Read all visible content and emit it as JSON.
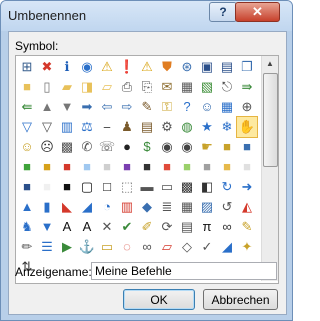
{
  "window": {
    "title": "Umbenennen",
    "help_label": "?",
    "close_label": "✕"
  },
  "symbol_label": "Symbol:",
  "symbols": [
    {
      "name": "org-chart-icon",
      "glyph": "⊞",
      "color": "#355c8c"
    },
    {
      "name": "error-icon",
      "glyph": "✖",
      "color": "#d4382b"
    },
    {
      "name": "info-icon",
      "glyph": "ℹ",
      "color": "#1f5fb8"
    },
    {
      "name": "record-icon",
      "glyph": "◉",
      "color": "#2a6fc9"
    },
    {
      "name": "warning-icon",
      "glyph": "⚠",
      "color": "#d9a413"
    },
    {
      "name": "exclamation-icon",
      "glyph": "❗",
      "color": "#d4382b"
    },
    {
      "name": "warning-icon",
      "glyph": "⚠",
      "color": "#d9a413"
    },
    {
      "name": "shield-icon",
      "glyph": "⛊",
      "color": "#e07d22"
    },
    {
      "name": "network-icon",
      "glyph": "⊛",
      "color": "#3a6fb0"
    },
    {
      "name": "save-icon",
      "glyph": "▣",
      "color": "#2b4f8a"
    },
    {
      "name": "save-all-icon",
      "glyph": "▤",
      "color": "#2b4f8a"
    },
    {
      "name": "copy-icon",
      "glyph": "❐",
      "color": "#3a6fb0"
    },
    {
      "name": "folder-icon",
      "glyph": "■",
      "color": "#e8c15a"
    },
    {
      "name": "new-document-icon",
      "glyph": "▯",
      "color": "#777777"
    },
    {
      "name": "open-folder-icon",
      "glyph": "▰",
      "color": "#e8c15a"
    },
    {
      "name": "folder-up-icon",
      "glyph": "◨",
      "color": "#e8c15a"
    },
    {
      "name": "open-icon",
      "glyph": "▱",
      "color": "#e8c15a"
    },
    {
      "name": "print-icon",
      "glyph": "⎙",
      "color": "#555555"
    },
    {
      "name": "print-preview-icon",
      "glyph": "⎘",
      "color": "#555555"
    },
    {
      "name": "mail-icon",
      "glyph": "✉",
      "color": "#8a6a2b"
    },
    {
      "name": "document-icon",
      "glyph": "▦",
      "color": "#5a5a5a"
    },
    {
      "name": "image-icon",
      "glyph": "▧",
      "color": "#3f8f3a"
    },
    {
      "name": "attachment-icon",
      "glyph": "⎋",
      "color": "#555555"
    },
    {
      "name": "send-icon",
      "glyph": "⇛",
      "color": "#3a8a3a"
    },
    {
      "name": "back-icon",
      "glyph": "⇚",
      "color": "#3a8a3a"
    },
    {
      "name": "triangle-up-icon",
      "glyph": "▲",
      "color": "#777777"
    },
    {
      "name": "triangle-down-icon",
      "glyph": "▼",
      "color": "#777777"
    },
    {
      "name": "arrow-right-icon",
      "glyph": "➡",
      "color": "#3a6fb0"
    },
    {
      "name": "back-circle-icon",
      "glyph": "⇦",
      "color": "#3a6fb0"
    },
    {
      "name": "forward-circle-icon",
      "glyph": "⇨",
      "color": "#3a6fb0"
    },
    {
      "name": "edit-icon",
      "glyph": "✎",
      "color": "#7a5a2b"
    },
    {
      "name": "key-icon",
      "glyph": "⚿",
      "color": "#c8a22a"
    },
    {
      "name": "help-icon",
      "glyph": "?",
      "color": "#2a6fc9"
    },
    {
      "name": "person-icon",
      "glyph": "☺",
      "color": "#3a6fb0"
    },
    {
      "name": "table-icon",
      "glyph": "▦",
      "color": "#2a6fc9"
    },
    {
      "name": "zoom-icon",
      "glyph": "⊕",
      "color": "#555555"
    },
    {
      "name": "filter-icon",
      "glyph": "▽",
      "color": "#2a6fc9"
    },
    {
      "name": "filter-icon",
      "glyph": "▽",
      "color": "#555555"
    },
    {
      "name": "book-icon",
      "glyph": "▥",
      "color": "#2a6fc9"
    },
    {
      "name": "balance-icon",
      "glyph": "⚖",
      "color": "#2a6fc9"
    },
    {
      "name": "clip-icon",
      "glyph": "⎯",
      "color": "#555555"
    },
    {
      "name": "users-icon",
      "glyph": "♟",
      "color": "#7a5a2b"
    },
    {
      "name": "clipboard-icon",
      "glyph": "▤",
      "color": "#7a5a2b"
    },
    {
      "name": "gear-icon",
      "glyph": "⚙",
      "color": "#555555"
    },
    {
      "name": "world-icon",
      "glyph": "◍",
      "color": "#3a8a3a"
    },
    {
      "name": "star-icon",
      "glyph": "★",
      "color": "#2a6fc9"
    },
    {
      "name": "snowflake-icon",
      "glyph": "❄",
      "color": "#2a6fc9"
    },
    {
      "name": "hand-icon",
      "glyph": "✋",
      "color": "#c8a22a"
    },
    {
      "name": "smiley-icon",
      "glyph": "☺",
      "color": "#c8a22a"
    },
    {
      "name": "sad-icon",
      "glyph": "☹",
      "color": "#333333"
    },
    {
      "name": "calculator-icon",
      "glyph": "▩",
      "color": "#555555"
    },
    {
      "name": "phone-icon",
      "glyph": "✆",
      "color": "#555555"
    },
    {
      "name": "chat-icon",
      "glyph": "☏",
      "color": "#555555"
    },
    {
      "name": "ball-icon",
      "glyph": "●",
      "color": "#222222"
    },
    {
      "name": "currency-icon",
      "glyph": "$",
      "color": "#3a8a3a"
    },
    {
      "name": "eye-icon",
      "glyph": "◉",
      "color": "#444444"
    },
    {
      "name": "eye-icon",
      "glyph": "◉",
      "color": "#444444"
    },
    {
      "name": "hand-icon",
      "glyph": "☛",
      "color": "#c8a22a"
    },
    {
      "name": "folder-icon",
      "glyph": "■",
      "color": "#c8a22a"
    },
    {
      "name": "color-swatch-icon",
      "glyph": "■",
      "color": "#3a6fb0"
    },
    {
      "name": "color-swatch-icon",
      "glyph": "■",
      "color": "#3fa33a"
    },
    {
      "name": "color-swatch-icon",
      "glyph": "■",
      "color": "#d6a11a"
    },
    {
      "name": "color-swatch-icon",
      "glyph": "■",
      "color": "#d4382b"
    },
    {
      "name": "color-swatch-icon",
      "glyph": "■",
      "color": "#a0c8f0"
    },
    {
      "name": "color-swatch-icon",
      "glyph": "■",
      "color": "#cfcfcf"
    },
    {
      "name": "color-swatch-icon",
      "glyph": "■",
      "color": "#7a3fb0"
    },
    {
      "name": "color-swatch-icon",
      "glyph": "■",
      "color": "#333333"
    },
    {
      "name": "color-swatch-icon",
      "glyph": "■",
      "color": "#e04a3a"
    },
    {
      "name": "color-swatch-icon",
      "glyph": "■",
      "color": "#9ad06a"
    },
    {
      "name": "color-swatch-icon",
      "glyph": "■",
      "color": "#a0a0a0"
    },
    {
      "name": "color-swatch-icon",
      "glyph": "■",
      "color": "#e6b94a"
    },
    {
      "name": "color-swatch-icon",
      "glyph": "■",
      "color": "#e0e0e0"
    },
    {
      "name": "color-swatch-icon",
      "glyph": "■",
      "color": "#2a4f8a"
    },
    {
      "name": "color-swatch-icon",
      "glyph": "■",
      "color": "#f0f0f0"
    },
    {
      "name": "color-swatch-icon",
      "glyph": "■",
      "color": "#111111"
    },
    {
      "name": "border-icon",
      "glyph": "▢",
      "color": "#111111"
    },
    {
      "name": "border-icon",
      "glyph": "□",
      "color": "#111111"
    },
    {
      "name": "border-icon",
      "glyph": "⬚",
      "color": "#777777"
    },
    {
      "name": "border-icon",
      "glyph": "▬",
      "color": "#555555"
    },
    {
      "name": "border-icon",
      "glyph": "▭",
      "color": "#555555"
    },
    {
      "name": "checker-icon",
      "glyph": "▩",
      "color": "#333333"
    },
    {
      "name": "align-icon",
      "glyph": "◧",
      "color": "#333333"
    },
    {
      "name": "refresh-icon",
      "glyph": "↻",
      "color": "#2a6fc9"
    },
    {
      "name": "arrow-right-icon",
      "glyph": "➜",
      "color": "#2a6fc9"
    },
    {
      "name": "drop-icon",
      "glyph": "▲",
      "color": "#2a6fc9"
    },
    {
      "name": "bar-chart-icon",
      "glyph": "▮",
      "color": "#2a6fc9"
    },
    {
      "name": "chart-icon",
      "glyph": "◣",
      "color": "#d4382b"
    },
    {
      "name": "chart-icon",
      "glyph": "◢",
      "color": "#2a6fc9"
    },
    {
      "name": "pie-chart-icon",
      "glyph": "◔",
      "color": "#2a6fc9"
    },
    {
      "name": "book-icon",
      "glyph": "▥",
      "color": "#d4382b"
    },
    {
      "name": "cube-icon",
      "glyph": "◆",
      "color": "#3a6fb0"
    },
    {
      "name": "stack-icon",
      "glyph": "≣",
      "color": "#555555"
    },
    {
      "name": "grid-icon",
      "glyph": "▦",
      "color": "#555555"
    },
    {
      "name": "picture-icon",
      "glyph": "▨",
      "color": "#3a6fb0"
    },
    {
      "name": "reload-icon",
      "glyph": "↺",
      "color": "#555555"
    },
    {
      "name": "shape-icon",
      "glyph": "◭",
      "color": "#d4382b"
    },
    {
      "name": "users-icon",
      "glyph": "♞",
      "color": "#2a6fc9"
    },
    {
      "name": "marker-icon",
      "glyph": "▼",
      "color": "#2a6fc9"
    },
    {
      "name": "text-icon",
      "glyph": "A",
      "color": "#111111"
    },
    {
      "name": "text-icon",
      "glyph": "A",
      "color": "#111111"
    },
    {
      "name": "delete-icon",
      "glyph": "✕",
      "color": "#555555"
    },
    {
      "name": "check-icon",
      "glyph": "✔",
      "color": "#3a8a3a"
    },
    {
      "name": "draw-icon",
      "glyph": "✐",
      "color": "#c8a22a"
    },
    {
      "name": "refresh-icon",
      "glyph": "⟳",
      "color": "#555555"
    },
    {
      "name": "table-icon",
      "glyph": "▤",
      "color": "#555555"
    },
    {
      "name": "pi-icon",
      "glyph": "π",
      "color": "#111111"
    },
    {
      "name": "binoculars-icon",
      "glyph": "∞",
      "color": "#333333"
    },
    {
      "name": "brush-icon",
      "glyph": "✎",
      "color": "#c8a22a"
    },
    {
      "name": "pencil-icon",
      "glyph": "✏",
      "color": "#555555"
    },
    {
      "name": "list-icon",
      "glyph": "☰",
      "color": "#2a6fc9"
    },
    {
      "name": "play-icon",
      "glyph": "▶",
      "color": "#3a8a3a"
    },
    {
      "name": "anchor-icon",
      "glyph": "⚓",
      "color": "#333333"
    },
    {
      "name": "ruler-icon",
      "glyph": "▭",
      "color": "#c8a22a"
    },
    {
      "name": "lasso-icon",
      "glyph": "◌",
      "color": "#d4382b"
    },
    {
      "name": "link-icon",
      "glyph": "∞",
      "color": "#555555"
    },
    {
      "name": "eraser-icon",
      "glyph": "▱",
      "color": "#d4382b"
    },
    {
      "name": "tag-icon",
      "glyph": "◇",
      "color": "#555555"
    },
    {
      "name": "check-icon",
      "glyph": "✓",
      "color": "#555555"
    },
    {
      "name": "tag-icon",
      "glyph": "◢",
      "color": "#2a6fc9"
    },
    {
      "name": "magic-icon",
      "glyph": "✦",
      "color": "#c8a22a"
    },
    {
      "name": "sort-icon",
      "glyph": "⇅",
      "color": "#333333"
    }
  ],
  "selected_symbol_index": 47,
  "scrollbar": {
    "up_label": "▲",
    "down_label": "▼"
  },
  "display_name_label": "Anzeigename:",
  "display_name_value": "Meine Befehle",
  "buttons": {
    "ok": "OK",
    "cancel": "Abbrechen"
  }
}
